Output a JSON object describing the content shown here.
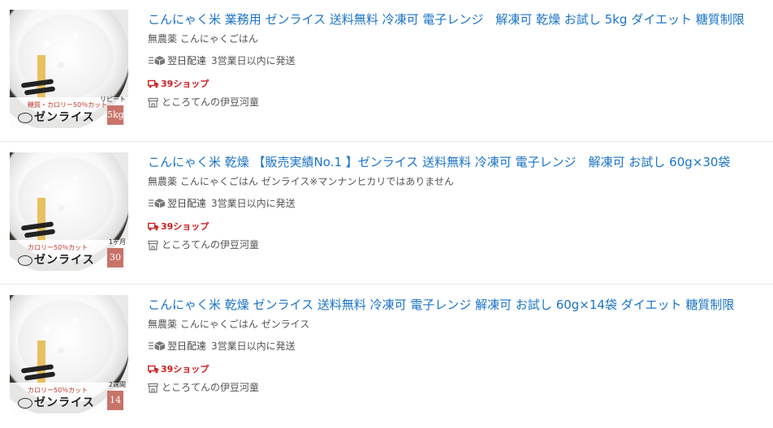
{
  "products": [
    {
      "title": "こんにゃく米 業務用 ゼンライス 送料無料 冷凍可 電子レンジ　解凍可 乾燥 お試し 5kg ダイエット 糖質制限",
      "subtitle": "無農薬 こんにゃくごはん",
      "shipping_label": "翌日配達",
      "shipping_note": "3営業日以内に発送",
      "shop39": "39ショップ",
      "store": "ところてんの伊豆河童",
      "thumb": {
        "cut_text": "糖質・カロリー50％カット",
        "brand": "ゼンライス",
        "badge_caption": "リピート",
        "badge": "5kg"
      }
    },
    {
      "title": "こんにゃく米 乾燥 【販売実績No.1 】ゼンライス 送料無料 冷凍可 電子レンジ　解凍可 お試し 60g×30袋",
      "subtitle": "無農薬 こんにゃくごはん ゼンライス※マンナンヒカリではありません",
      "shipping_label": "翌日配達",
      "shipping_note": "3営業日以内に発送",
      "shop39": "39ショップ",
      "store": "ところてんの伊豆河童",
      "thumb": {
        "cut_text": "カロリー50％カット",
        "brand": "ゼンライス",
        "badge_caption": "1ヶ月",
        "badge": "30袋"
      }
    },
    {
      "title": "こんにゃく米 乾燥 ゼンライス 送料無料 冷凍可 電子レンジ 解凍可 お試し 60g×14袋 ダイエット 糖質制限",
      "subtitle": "無農薬 こんにゃくごはん ゼンライス",
      "shipping_label": "翌日配達",
      "shipping_note": "3営業日以内に発送",
      "shop39": "39ショップ",
      "store": "ところてんの伊豆河童",
      "thumb": {
        "cut_text": "カロリー50％カット",
        "brand": "ゼンライス",
        "badge_caption": "2週間",
        "badge": "14袋"
      }
    }
  ],
  "colors": {
    "title_link": "#1a73c9",
    "shop39_red": "#cc2020",
    "divider": "#e6e6e6"
  },
  "icons": {
    "shipping": "box-icon",
    "shop39": "truck-icon",
    "store": "storefront-icon"
  }
}
